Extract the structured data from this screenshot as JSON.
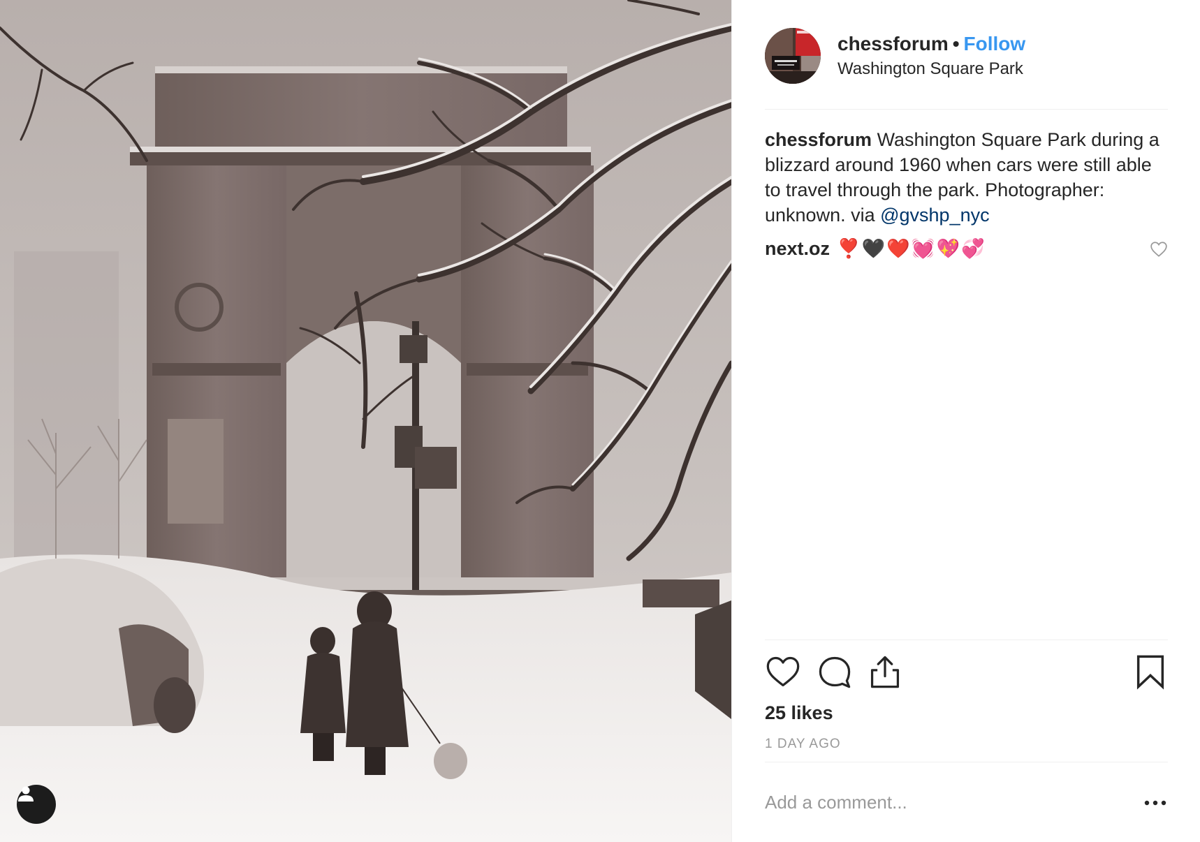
{
  "post": {
    "username": "chessforum",
    "separator": "•",
    "follow_label": "Follow",
    "location": "Washington Square Park",
    "avatar_icon": "chess-forum-store-avatar",
    "photo_icon": "snowy-washington-square-arch-photo"
  },
  "caption": {
    "username": "chessforum",
    "text": " Washington Square Park during a blizzard around 1960 when cars were still able to travel through the park. Photographer: unknown. via ",
    "mention": "@gvshp_nyc"
  },
  "comments": [
    {
      "username": "next.oz",
      "text": "❣️🖤❤️💓💖💞"
    }
  ],
  "stats": {
    "likes": "25 likes",
    "timestamp": "1 DAY AGO"
  },
  "comment_box": {
    "placeholder": "Add a comment..."
  },
  "colors": {
    "follow": "#3897f0",
    "mention": "#003569",
    "muted": "#999999",
    "divider": "#efefef",
    "text": "#262626"
  }
}
